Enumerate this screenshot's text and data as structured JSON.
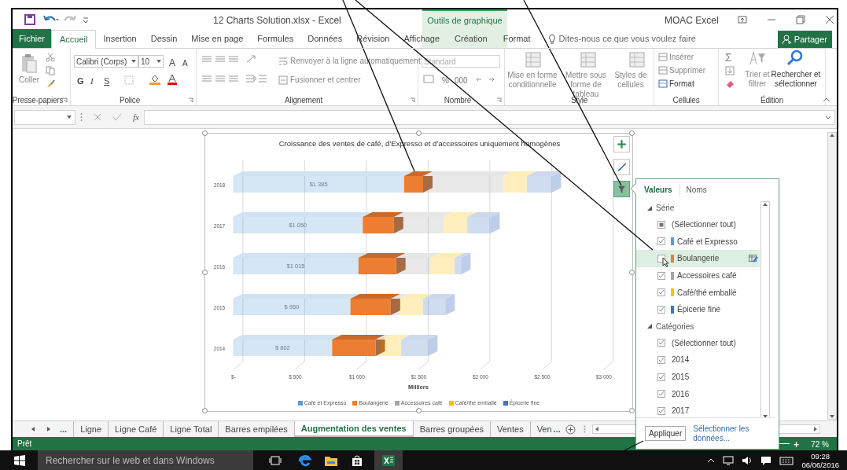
{
  "window": {
    "title": "12 Charts Solution.xlsx - Excel",
    "account": "MOAC Excel",
    "contextual_group": "Outils de graphique"
  },
  "ribbon_tabs": [
    {
      "label": "Fichier",
      "kind": "file",
      "selected": false
    },
    {
      "label": "Accueil",
      "kind": "normal",
      "selected": true
    },
    {
      "label": "Insertion",
      "kind": "normal",
      "selected": false
    },
    {
      "label": "Dessin",
      "kind": "normal",
      "selected": false
    },
    {
      "label": "Mise en page",
      "kind": "normal",
      "selected": false
    },
    {
      "label": "Formules",
      "kind": "normal",
      "selected": false
    },
    {
      "label": "Données",
      "kind": "normal",
      "selected": false
    },
    {
      "label": "Révision",
      "kind": "normal",
      "selected": false
    },
    {
      "label": "Affichage",
      "kind": "normal",
      "selected": false
    },
    {
      "label": "Création",
      "kind": "contextual",
      "selected": false
    },
    {
      "label": "Format",
      "kind": "contextual",
      "selected": false
    }
  ],
  "tell_me": "Dites-nous ce que vous voulez faire",
  "share_button": "Partager",
  "ribbon": {
    "clipboard": {
      "label": "Presse-papiers",
      "paste": "Coller"
    },
    "font": {
      "label": "Police",
      "font_name": "Calibri (Corps)",
      "font_size": "10",
      "size_buttons": [
        "A",
        "A"
      ],
      "buttons": [
        "G",
        "I",
        "S"
      ]
    },
    "alignment": {
      "label": "Alignement",
      "wrap": "Renvoyer à la ligne automatiquement",
      "merge": "Fusionner et centrer"
    },
    "number": {
      "label": "Nombre",
      "format": "Standard",
      "buttons": [
        "%",
        "000"
      ]
    },
    "style": {
      "label": "Style",
      "buttons": [
        "Mise en forme conditionnelle",
        "Mettre sous forme de tableau",
        "Styles de cellules"
      ]
    },
    "cells": {
      "label": "Cellules",
      "buttons": [
        "Insérer",
        "Supprimer",
        "Format"
      ]
    },
    "editing": {
      "label": "Édition",
      "autosum": "Σ",
      "buttons": [
        "Trier et filtrer",
        "Rechercher et sélectionner"
      ]
    }
  },
  "formula_bar": {
    "fx": "fx"
  },
  "chart": {
    "chart_data": {
      "type": "bar",
      "orientation": "horizontal",
      "stacked": true,
      "title": "Croissance des ventes de café, d’Expresso et d’accessoires uniquement homogènes",
      "xlabel": "Milliers",
      "categories": [
        "2018",
        "2017",
        "2016",
        "2015",
        "2014"
      ],
      "series": [
        {
          "name": "Café et Expresso",
          "color": "#5b9bd5",
          "values": [
            1385,
            1050,
            1015,
            950,
            802
          ]
        },
        {
          "name": "Boulangerie",
          "color": "#ed7d31",
          "values": [
            154,
            252,
            305,
            327,
            352
          ]
        },
        {
          "name": "Accessoires café",
          "color": "#a5a5a5",
          "values": [
            652,
            400,
            277,
            70,
            43
          ]
        },
        {
          "name": "Café/thé emballé",
          "color": "#ffc000",
          "values": [
            189,
            195,
            198,
            191,
            164
          ]
        },
        {
          "name": "Épicerie fine",
          "color": "#4472c4",
          "values": [
            200,
            186,
            52,
            182,
            218
          ]
        }
      ],
      "value_labels": [
        "$1 385",
        "$1 050",
        "$1 015",
        "$ 950",
        "$ 802"
      ],
      "xlim": [
        0,
        3000
      ],
      "xticks": [
        {
          "value": 0,
          "label": "$-"
        },
        {
          "value": 500,
          "label": "$ 500"
        },
        {
          "value": 1000,
          "label": "$1 000"
        },
        {
          "value": 1500,
          "label": "$1 500"
        },
        {
          "value": 2000,
          "label": "$2 000"
        },
        {
          "value": 2500,
          "label": "$2 500"
        },
        {
          "value": 3000,
          "label": "$3 000"
        }
      ]
    }
  },
  "filter_panel": {
    "tabs": [
      {
        "label": "Valeurs",
        "selected": true
      },
      {
        "label": "Noms",
        "selected": false
      }
    ],
    "sections": [
      {
        "label": "Série",
        "expanded": true,
        "items": [
          {
            "label": "(Sélectionner tout)",
            "checked": false,
            "indeterminate": true,
            "hovered": false
          },
          {
            "label": "Café et Expresso",
            "checked": true,
            "indeterminate": false,
            "color": "#5b9bd5",
            "hovered": false
          },
          {
            "label": "Boulangerie",
            "checked": false,
            "indeterminate": false,
            "color": "#ed7d31",
            "hovered": true
          },
          {
            "label": "Accessoires café",
            "checked": true,
            "indeterminate": false,
            "color": "#a5a5a5",
            "hovered": false
          },
          {
            "label": "Café/thé emballé",
            "checked": true,
            "indeterminate": false,
            "color": "#ffc000",
            "hovered": false
          },
          {
            "label": "Épicerie fine",
            "checked": true,
            "indeterminate": false,
            "color": "#4472c4",
            "hovered": false
          }
        ]
      },
      {
        "label": "Catégories",
        "expanded": true,
        "items": [
          {
            "label": "(Sélectionner tout)",
            "checked": true,
            "indeterminate": false,
            "hovered": false
          },
          {
            "label": "2014",
            "checked": true,
            "indeterminate": false,
            "hovered": false
          },
          {
            "label": "2015",
            "checked": true,
            "indeterminate": false,
            "hovered": false
          },
          {
            "label": "2016",
            "checked": true,
            "indeterminate": false,
            "hovered": false
          },
          {
            "label": "2017",
            "checked": true,
            "indeterminate": false,
            "hovered": false
          }
        ]
      }
    ],
    "apply_button": "Appliquer",
    "select_data_link": "Sélectionner les données..."
  },
  "sheet_tabs": [
    {
      "label": "Ligne",
      "selected": false
    },
    {
      "label": "Ligne Café",
      "selected": false
    },
    {
      "label": "Ligne Total",
      "selected": false
    },
    {
      "label": "Barres empilées",
      "selected": false
    },
    {
      "label": "Augmentation des ventes",
      "selected": true
    },
    {
      "label": "Barres groupées",
      "selected": false
    },
    {
      "label": "Ventes",
      "selected": false
    },
    {
      "label": "Ven",
      "selected": false
    }
  ],
  "sheet_nav": {
    "more_left": "...",
    "more_right": "..."
  },
  "status_bar": {
    "status": "Prêt",
    "zoom_in": "+",
    "zoom": "72 %"
  },
  "taskbar": {
    "search_placeholder": "Rechercher sur le web et dans Windows",
    "time": "09:28",
    "date": "06/06/2016"
  }
}
